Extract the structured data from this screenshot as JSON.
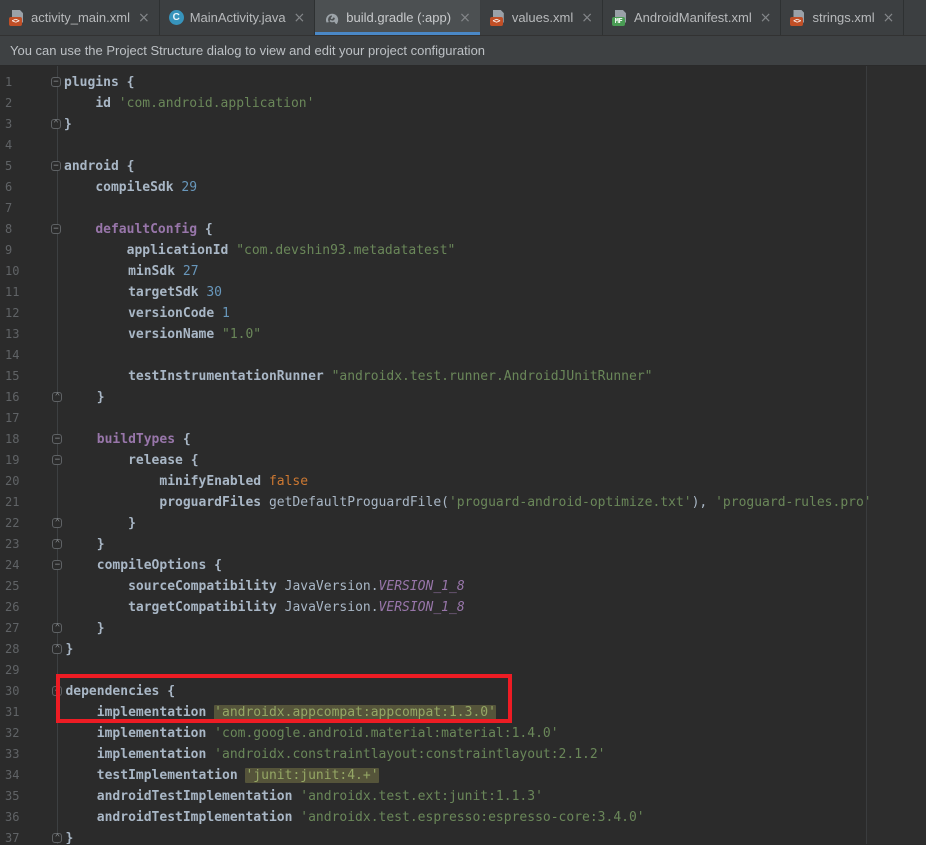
{
  "tab_bar": {
    "close_glyph": "×",
    "badges": {
      "xml": "<>",
      "manifest": "MF",
      "class": "C"
    },
    "tabs": [
      {
        "label": "activity_main.xml",
        "icon": "xml-file-icon",
        "active": false
      },
      {
        "label": "MainActivity.java",
        "icon": "java-class-icon",
        "active": false
      },
      {
        "label": "build.gradle (:app)",
        "icon": "gradle-icon",
        "active": true
      },
      {
        "label": "values.xml",
        "icon": "xml-file-icon",
        "active": false
      },
      {
        "label": "AndroidManifest.xml",
        "icon": "manifest-file-icon",
        "active": false
      },
      {
        "label": "strings.xml",
        "icon": "xml-file-icon",
        "active": false
      }
    ]
  },
  "banner": {
    "text": "You can use the Project Structure dialog to view and edit your project configuration"
  },
  "colors": {
    "editor_bg": "#2B2B2B",
    "tabbar_bg": "#3C3F41",
    "active_tab_bg": "#4C5052",
    "active_tab_underline": "#4A88C7",
    "banner_bg": "#3E4143",
    "default_text": "#A9B7C6",
    "string": "#6A8759",
    "number": "#6897BB",
    "keyword": "#CC7832",
    "block_name": "#9876AA",
    "line_number": "#606366",
    "highlight_bg": "#55543A",
    "annotation_red": "#ED1C24"
  },
  "annotation": {
    "shape": "rectangle",
    "color": "#ED1C24",
    "around_lines": "30-31"
  },
  "editor": {
    "lines": [
      {
        "num": 1,
        "fold": "start",
        "tokens": [
          [
            "b",
            "plugins {"
          ]
        ]
      },
      {
        "num": 2,
        "fold": null,
        "tokens": [
          [
            "d",
            "    "
          ],
          [
            "b",
            "id "
          ],
          [
            "s",
            "'com.android.application'"
          ]
        ]
      },
      {
        "num": 3,
        "fold": "end",
        "tokens": [
          [
            "b",
            "}"
          ]
        ]
      },
      {
        "num": 4,
        "fold": null,
        "tokens": []
      },
      {
        "num": 5,
        "fold": "start",
        "tokens": [
          [
            "b",
            "android {"
          ]
        ]
      },
      {
        "num": 6,
        "fold": null,
        "tokens": [
          [
            "d",
            "    "
          ],
          [
            "b",
            "compileSdk "
          ],
          [
            "n",
            "29"
          ]
        ]
      },
      {
        "num": 7,
        "fold": null,
        "tokens": []
      },
      {
        "num": 8,
        "fold": "start",
        "tokens": [
          [
            "d",
            "    "
          ],
          [
            "p",
            "defaultConfig "
          ],
          [
            "b",
            "{"
          ]
        ]
      },
      {
        "num": 9,
        "fold": null,
        "tokens": [
          [
            "d",
            "        "
          ],
          [
            "b",
            "applicationId "
          ],
          [
            "s",
            "\"com.devshin93.metadatatest\""
          ]
        ]
      },
      {
        "num": 10,
        "fold": null,
        "tokens": [
          [
            "d",
            "        "
          ],
          [
            "b",
            "minSdk "
          ],
          [
            "n",
            "27"
          ]
        ]
      },
      {
        "num": 11,
        "fold": null,
        "tokens": [
          [
            "d",
            "        "
          ],
          [
            "b",
            "targetSdk "
          ],
          [
            "n",
            "30"
          ]
        ]
      },
      {
        "num": 12,
        "fold": null,
        "tokens": [
          [
            "d",
            "        "
          ],
          [
            "b",
            "versionCode "
          ],
          [
            "n",
            "1"
          ]
        ]
      },
      {
        "num": 13,
        "fold": null,
        "tokens": [
          [
            "d",
            "        "
          ],
          [
            "b",
            "versionName "
          ],
          [
            "s",
            "\"1.0\""
          ]
        ]
      },
      {
        "num": 14,
        "fold": null,
        "tokens": []
      },
      {
        "num": 15,
        "fold": null,
        "tokens": [
          [
            "d",
            "        "
          ],
          [
            "b",
            "testInstrumentationRunner "
          ],
          [
            "s",
            "\"androidx.test.runner.AndroidJUnitRunner\""
          ]
        ]
      },
      {
        "num": 16,
        "fold": "end",
        "tokens": [
          [
            "d",
            "    "
          ],
          [
            "b",
            "}"
          ]
        ]
      },
      {
        "num": 17,
        "fold": null,
        "tokens": []
      },
      {
        "num": 18,
        "fold": "start",
        "tokens": [
          [
            "d",
            "    "
          ],
          [
            "p",
            "buildTypes "
          ],
          [
            "b",
            "{"
          ]
        ]
      },
      {
        "num": 19,
        "fold": "start",
        "tokens": [
          [
            "d",
            "        "
          ],
          [
            "b",
            "release {"
          ]
        ]
      },
      {
        "num": 20,
        "fold": null,
        "tokens": [
          [
            "d",
            "            "
          ],
          [
            "b",
            "minifyEnabled "
          ],
          [
            "k",
            "false"
          ]
        ]
      },
      {
        "num": 21,
        "fold": null,
        "tokens": [
          [
            "d",
            "            "
          ],
          [
            "b",
            "proguardFiles "
          ],
          [
            "d",
            "getDefaultProguardFile("
          ],
          [
            "s",
            "'proguard-android-optimize.txt'"
          ],
          [
            "d",
            "), "
          ],
          [
            "s",
            "'proguard-rules.pro'"
          ]
        ]
      },
      {
        "num": 22,
        "fold": "end",
        "tokens": [
          [
            "d",
            "        "
          ],
          [
            "b",
            "}"
          ]
        ]
      },
      {
        "num": 23,
        "fold": "end",
        "tokens": [
          [
            "d",
            "    "
          ],
          [
            "b",
            "}"
          ]
        ]
      },
      {
        "num": 24,
        "fold": "start",
        "tokens": [
          [
            "d",
            "    "
          ],
          [
            "b",
            "compileOptions {"
          ]
        ]
      },
      {
        "num": 25,
        "fold": null,
        "tokens": [
          [
            "d",
            "        "
          ],
          [
            "b",
            "sourceCompatibility "
          ],
          [
            "d",
            "JavaVersion."
          ],
          [
            "c",
            "VERSION_1_8"
          ]
        ]
      },
      {
        "num": 26,
        "fold": null,
        "tokens": [
          [
            "d",
            "        "
          ],
          [
            "b",
            "targetCompatibility "
          ],
          [
            "d",
            "JavaVersion."
          ],
          [
            "c",
            "VERSION_1_8"
          ]
        ]
      },
      {
        "num": 27,
        "fold": "end",
        "tokens": [
          [
            "d",
            "    "
          ],
          [
            "b",
            "}"
          ]
        ]
      },
      {
        "num": 28,
        "fold": "end",
        "tokens": [
          [
            "b",
            "}"
          ]
        ]
      },
      {
        "num": 29,
        "fold": null,
        "tokens": []
      },
      {
        "num": 30,
        "fold": "start",
        "tokens": [
          [
            "b",
            "dependencies {"
          ]
        ]
      },
      {
        "num": 31,
        "fold": null,
        "tokens": [
          [
            "d",
            "    "
          ],
          [
            "b",
            "implementation "
          ],
          [
            "hs",
            "'androidx.appcompat:appcompat:1.3.0'"
          ]
        ]
      },
      {
        "num": 32,
        "fold": null,
        "tokens": [
          [
            "d",
            "    "
          ],
          [
            "b",
            "implementation "
          ],
          [
            "s",
            "'com.google.android.material:material:1.4.0'"
          ]
        ]
      },
      {
        "num": 33,
        "fold": null,
        "tokens": [
          [
            "d",
            "    "
          ],
          [
            "b",
            "implementation "
          ],
          [
            "s",
            "'androidx.constraintlayout:constraintlayout:2.1.2'"
          ]
        ]
      },
      {
        "num": 34,
        "fold": null,
        "tokens": [
          [
            "d",
            "    "
          ],
          [
            "b",
            "testImplementation "
          ],
          [
            "hs",
            "'junit:junit:4.+'"
          ]
        ]
      },
      {
        "num": 35,
        "fold": null,
        "tokens": [
          [
            "d",
            "    "
          ],
          [
            "b",
            "androidTestImplementation "
          ],
          [
            "s",
            "'androidx.test.ext:junit:1.1.3'"
          ]
        ]
      },
      {
        "num": 36,
        "fold": null,
        "tokens": [
          [
            "d",
            "    "
          ],
          [
            "b",
            "androidTestImplementation "
          ],
          [
            "s",
            "'androidx.test.espresso:espresso-core:3.4.0'"
          ]
        ]
      },
      {
        "num": 37,
        "fold": "end",
        "tokens": [
          [
            "b",
            "}"
          ]
        ]
      }
    ]
  }
}
